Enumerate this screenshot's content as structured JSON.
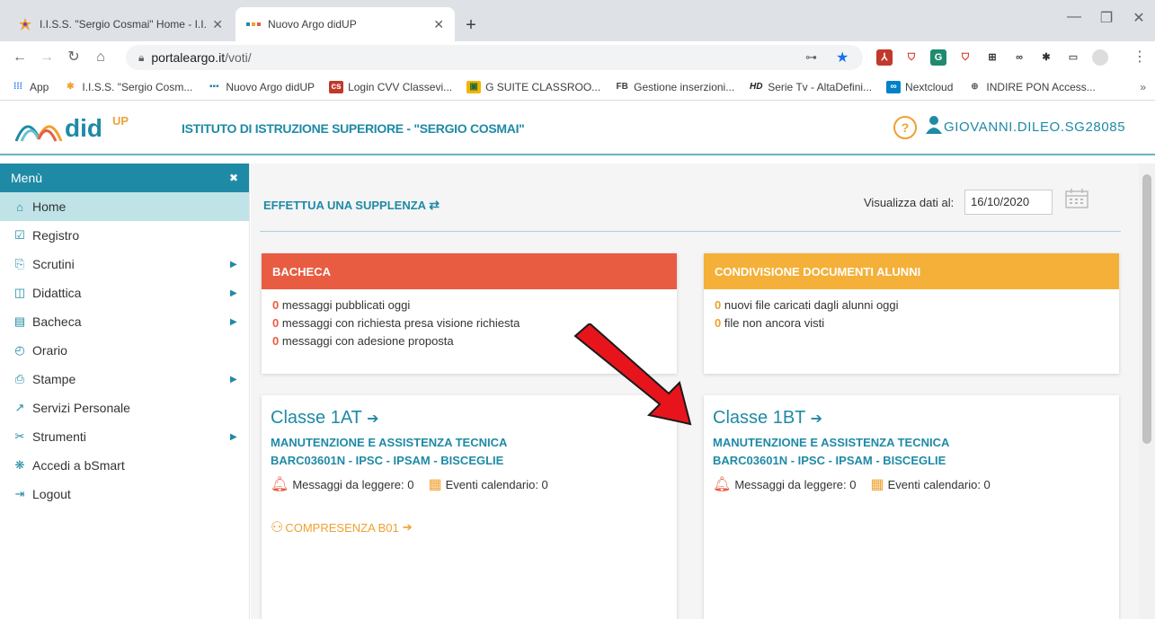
{
  "browser": {
    "tabs": [
      {
        "title": "I.I.S.S. \"Sergio Cosmai\" Home - I.I.",
        "active": false
      },
      {
        "title": "Nuovo Argo didUP",
        "active": true
      }
    ],
    "url_host": "portaleargo.it",
    "url_path": "/voti/",
    "bookmarks": [
      {
        "label": "App",
        "icon": "apps-icon"
      },
      {
        "label": "I.I.S.S. \"Sergio Cosm...",
        "icon": "school-favicon"
      },
      {
        "label": "Nuovo Argo didUP",
        "icon": "argo-favicon"
      },
      {
        "label": "Login CVV Classevi...",
        "icon": "classeviva-favicon"
      },
      {
        "label": "G SUITE CLASSROO...",
        "icon": "classroom-favicon"
      },
      {
        "label": "Gestione inserzioni...",
        "icon": "fb-favicon"
      },
      {
        "label": "Serie Tv - AltaDefini...",
        "icon": "hd-favicon"
      },
      {
        "label": "Nextcloud",
        "icon": "nextcloud-favicon"
      },
      {
        "label": "INDIRE PON Access...",
        "icon": "globe-icon"
      }
    ],
    "bookmarks_more": "»"
  },
  "app": {
    "logo_text": "did",
    "logo_sup": "UP",
    "school_name": "ISTITUTO DI ISTRUZIONE SUPERIORE - \"SERGIO COSMAI\"",
    "help": "?",
    "user": "GIOVANNI.DILEO.SG28085"
  },
  "menu": {
    "title": "Menù",
    "close": "✖",
    "items": [
      {
        "label": "Home",
        "icon": "home-icon",
        "arrow": false,
        "active": true
      },
      {
        "label": "Registro",
        "icon": "calendar-check-icon",
        "arrow": false
      },
      {
        "label": "Scrutini",
        "icon": "document-icon",
        "arrow": true
      },
      {
        "label": "Didattica",
        "icon": "book-icon",
        "arrow": true
      },
      {
        "label": "Bacheca",
        "icon": "newspaper-icon",
        "arrow": true
      },
      {
        "label": "Orario",
        "icon": "clock-icon",
        "arrow": false
      },
      {
        "label": "Stampe",
        "icon": "printer-icon",
        "arrow": true
      },
      {
        "label": "Servizi Personale",
        "icon": "share-icon",
        "arrow": false
      },
      {
        "label": "Strumenti",
        "icon": "tools-icon",
        "arrow": true
      },
      {
        "label": "Accedi a bSmart",
        "icon": "bsmart-icon",
        "arrow": false
      },
      {
        "label": "Logout",
        "icon": "logout-icon",
        "arrow": false
      }
    ]
  },
  "main": {
    "supplenza": "EFFETTUA UNA SUPPLENZA",
    "date_label": "Visualizza dati al:",
    "date_value": "16/10/2020",
    "bacheca": {
      "title": "BACHECA",
      "color": "#e85c41",
      "lines": [
        {
          "n": "0",
          "text": "messaggi pubblicati oggi"
        },
        {
          "n": "0",
          "text": "messaggi con richiesta presa visione richiesta"
        },
        {
          "n": "0",
          "text": "messaggi con adesione proposta"
        }
      ]
    },
    "condivisione": {
      "title": "CONDIVISIONE DOCUMENTI ALUNNI",
      "color": "#f4b038",
      "lines": [
        {
          "n": "0",
          "text": "nuovi file caricati dagli alunni oggi"
        },
        {
          "n": "0",
          "text": "file non ancora visti"
        }
      ]
    },
    "classes": [
      {
        "title": "Classe 1AT",
        "course": "MANUTENZIONE E ASSISTENZA TECNICA",
        "school": "BARC03601N - IPSC - IPSAM - BISCEGLIE",
        "messages": "Messaggi da leggere: 0",
        "events": "Eventi calendario: 0",
        "compresenza": "COMPRESENZA B01"
      },
      {
        "title": "Classe 1BT",
        "course": "MANUTENZIONE E ASSISTENZA TECNICA",
        "school": "BARC03601N - IPSC - IPSAM - BISCEGLIE",
        "messages": "Messaggi da leggere: 0",
        "events": "Eventi calendario: 0"
      }
    ]
  },
  "colors": {
    "brand": "#1f8aa6",
    "accent": "#f0a030",
    "annotation_arrow": "#e8141c"
  }
}
